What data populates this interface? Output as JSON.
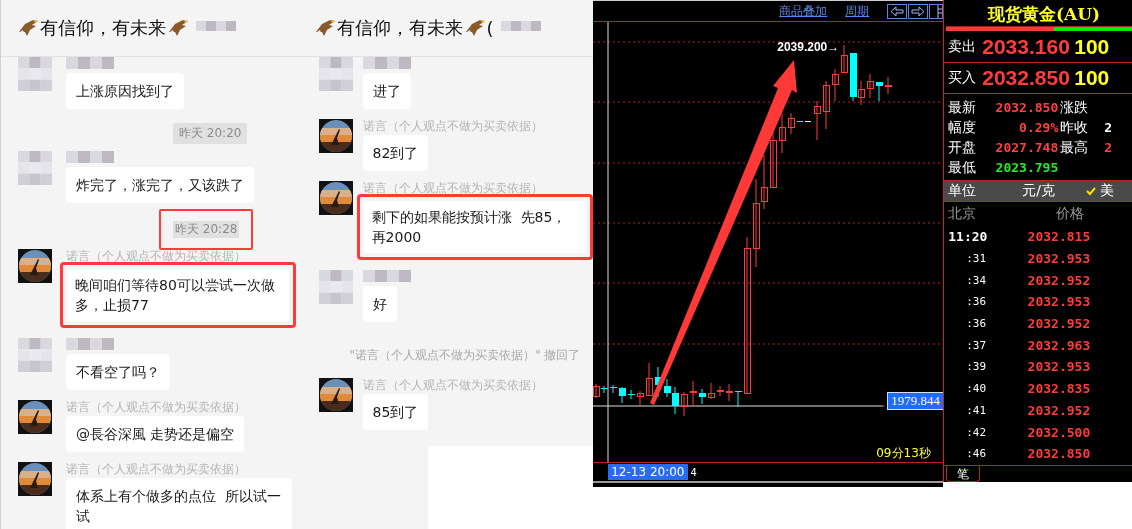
{
  "chats": [
    {
      "title": "有信仰，有未来",
      "messages": [
        {
          "kind": "blurred",
          "text": "上涨原因找到了",
          "highlighted": false
        },
        {
          "kind": "time",
          "text": "昨天 20:20",
          "highlighted": false
        },
        {
          "kind": "blurred",
          "text": "炸完了，涨完了，又该跌了",
          "highlighted": false
        },
        {
          "kind": "time",
          "text": "昨天 20:28",
          "highlighted": true
        },
        {
          "sender": "诺言（个人观点不做为买卖依据）",
          "text": "晚间咱们等待80可以尝试一次做多，止损77",
          "highlighted": true
        },
        {
          "kind": "blurred",
          "text": "不看空了吗？",
          "highlighted": false
        },
        {
          "sender": "诺言（个人观点不做为买卖依据）",
          "text": "@長谷深風 走势还是偏空",
          "highlighted": false
        },
        {
          "sender": "诺言（个人观点不做为买卖依据）",
          "text": "体系上有个做多的点位  所以试一试",
          "highlighted": false
        }
      ]
    },
    {
      "title": "有信仰，有未来",
      "title_tail": "(",
      "messages": [
        {
          "kind": "blurred",
          "text": "进了",
          "highlighted": false
        },
        {
          "sender": "诺言（个人观点不做为买卖依据）",
          "text": "82到了",
          "highlighted": false
        },
        {
          "sender": "诺言（个人观点不做为买卖依据）",
          "text": "剩下的如果能按预计涨  先85，再2000",
          "highlighted": true
        },
        {
          "kind": "blurred",
          "text": "好",
          "highlighted": false
        },
        {
          "kind": "system",
          "text": "\"诺言（个人观点不做为买卖依据）\" 撤回了"
        },
        {
          "sender": "诺言（个人观点不做为买卖依据）",
          "text": "85到了",
          "highlighted": false
        }
      ]
    }
  ],
  "chart": {
    "links": [
      "商品叠加",
      "周期"
    ],
    "high_label": "2039.200→",
    "price_tag": "1979.844",
    "countdown": "09分13秒",
    "time_tag": "12-13 20:00",
    "time_tail": "4"
  },
  "quote": {
    "title": "现货黄金(AU)",
    "bar": {
      "level": 0.58
    },
    "orders": [
      {
        "label": "卖出",
        "price": "2033.160",
        "volume": "100"
      },
      {
        "label": "买入",
        "price": "2032.850",
        "volume": "100"
      }
    ],
    "stats": [
      {
        "label": "最新",
        "value": "2032.850",
        "color": "#ff4040"
      },
      {
        "label": "涨跌"
      },
      {
        "label": "幅度",
        "value": "0.29%",
        "color": "#ff4040"
      },
      {
        "label": "昨收",
        "value": "2",
        "color": "#ffffff"
      },
      {
        "label": "开盘",
        "value": "2027.748",
        "color": "#ff4040"
      },
      {
        "label": "最高",
        "value": "2",
        "color": "#ff4040"
      },
      {
        "label": "最低",
        "value": "2023.795",
        "color": "#22ee22"
      }
    ],
    "unit_label": "单位",
    "unit": "元/克",
    "currency": "美",
    "currency_checked": true,
    "columns": [
      "北京",
      "价格"
    ],
    "ticks": [
      {
        "kind": "hour",
        "time": "11:20",
        "price": "2032.815"
      },
      {
        "kind": "minute",
        "time": ":31",
        "price": "2032.953"
      },
      {
        "kind": "minute",
        "time": ":34",
        "price": "2032.952"
      },
      {
        "kind": "minute",
        "time": ":36",
        "price": "2032.953"
      },
      {
        "kind": "minute",
        "time": ":36",
        "price": "2032.952"
      },
      {
        "kind": "minute",
        "time": ":37",
        "price": "2032.963"
      },
      {
        "kind": "minute",
        "time": ":39",
        "price": "2032.953"
      },
      {
        "kind": "minute",
        "time": ":40",
        "price": "2032.835"
      },
      {
        "kind": "minute",
        "time": ":41",
        "price": "2032.952"
      },
      {
        "kind": "minute",
        "time": ":42",
        "price": "2032.500"
      },
      {
        "kind": "minute",
        "time": ":46",
        "price": "2032.850"
      }
    ],
    "tab": "笔"
  }
}
